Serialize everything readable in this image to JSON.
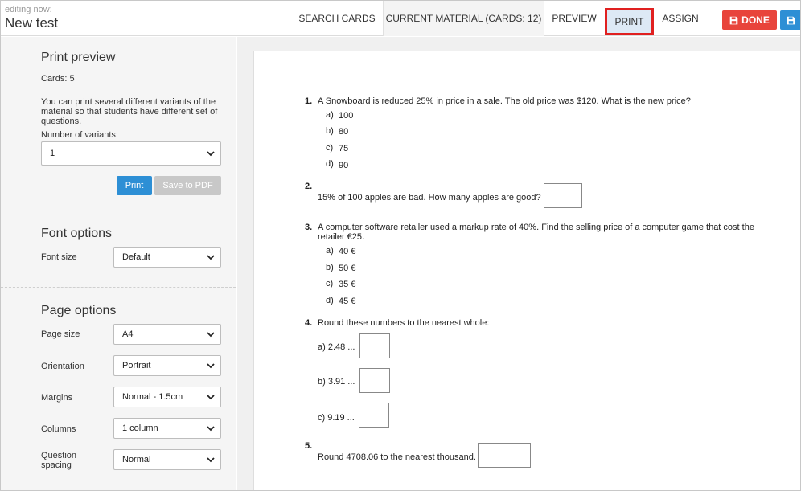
{
  "header": {
    "editing_label": "editing now:",
    "title": "New test",
    "nav": {
      "search": "SEARCH CARDS",
      "current": "CURRENT MATERIAL (CARDS: 12)",
      "preview": "PREVIEW",
      "print": "PRINT",
      "assign": "ASSIGN"
    },
    "done_label": "DONE",
    "icons": {
      "done": "save-icon",
      "save": "save-icon"
    },
    "colors": {
      "done": "#e8443b",
      "accent": "#2d8fd5",
      "highlight": "#e02020"
    }
  },
  "sidebar": {
    "print_preview": {
      "title": "Print preview",
      "cards": "Cards: 5",
      "description_line1": "You can print several different variants of the",
      "description_line2": "material so that students have different set of",
      "description_line3": "questions.",
      "variants_label": "Number of variants:",
      "variants_value": "1",
      "print_button": "Print",
      "pdf_button": "Save to PDF"
    },
    "font_options": {
      "title": "Font options",
      "font_size_label": "Font size",
      "font_size_value": "Default"
    },
    "page_options": {
      "title": "Page options",
      "page_size_label": "Page size",
      "page_size_value": "A4",
      "orientation_label": "Orientation",
      "orientation_value": "Portrait",
      "margins_label": "Margins",
      "margins_value": "Normal - 1.5cm",
      "columns_label": "Columns",
      "columns_value": "1 column",
      "spacing_label_line1": "Question",
      "spacing_label_line2": "spacing",
      "spacing_value": "Normal"
    }
  },
  "questions": [
    {
      "num": "1.",
      "text": "A Snowboard is reduced 25% in price in a sale. The old price was $120. What is the new price?",
      "options": [
        {
          "letter": "a)",
          "value": "100"
        },
        {
          "letter": "b)",
          "value": "80"
        },
        {
          "letter": "c)",
          "value": "75"
        },
        {
          "letter": "d)",
          "value": "90"
        }
      ]
    },
    {
      "num": "2.",
      "text": "15% of 100 apples are bad. How many apples are good?"
    },
    {
      "num": "3.",
      "text_line1": "A computer software retailer used a markup rate of 40%. Find the selling price of a computer game that cost the",
      "text_line2": "retailer €25.",
      "options": [
        {
          "letter": "a)",
          "value": "40 €"
        },
        {
          "letter": "b)",
          "value": "50 €"
        },
        {
          "letter": "c)",
          "value": "35 €"
        },
        {
          "letter": "d)",
          "value": "45 €"
        }
      ]
    },
    {
      "num": "4.",
      "text": "Round these numbers to the nearest whole:",
      "parts": [
        "a) 2.48 ...",
        "b) 3.91 ...",
        "c) 9.19 ..."
      ]
    },
    {
      "num": "5.",
      "text": "Round 4708.06 to the nearest thousand."
    }
  ]
}
